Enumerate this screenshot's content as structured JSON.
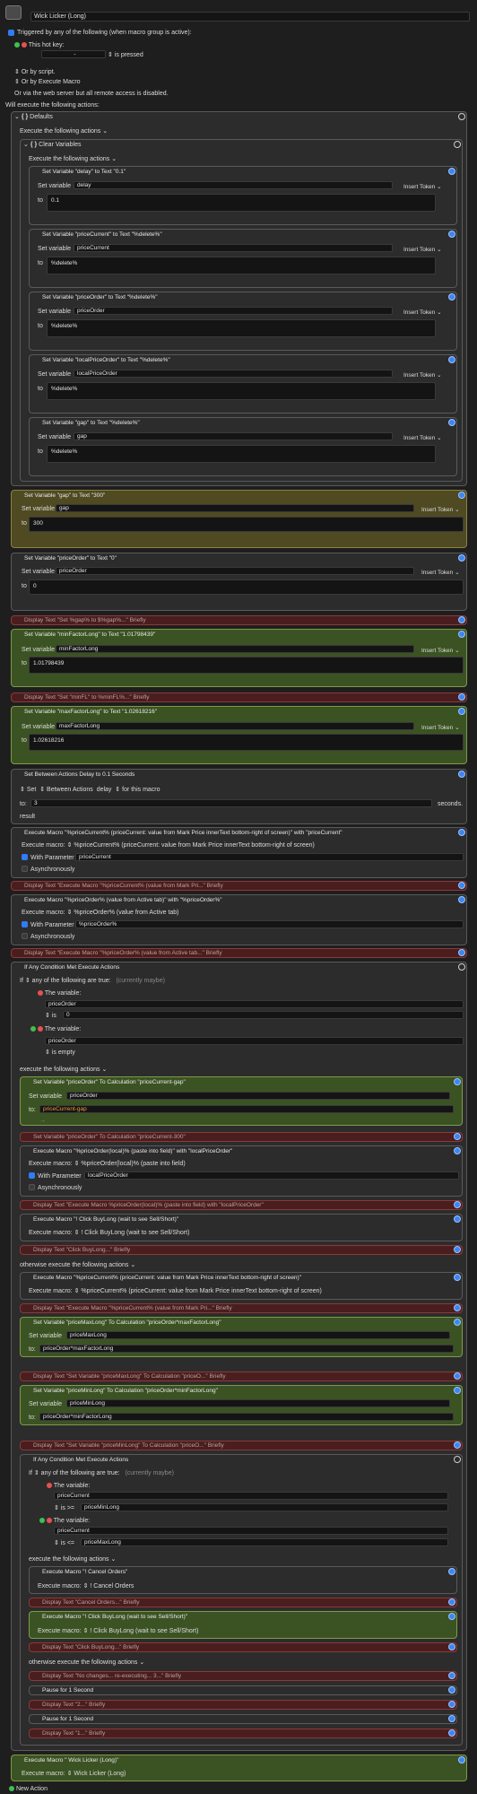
{
  "macro": {
    "title": "Wick Licker (Long)"
  },
  "trigger": {
    "triggered_by": "Triggered by any of the following (when macro group is active):",
    "hot_key_label": "This hot key:",
    "hot_key_value": "-",
    "is_pressed": "is pressed",
    "or_script": "Or by script.",
    "or_execute": "Or by Execute Macro",
    "or_web": "Or via the web server but all remote access is disabled."
  },
  "will_execute": "Will execute the following actions:",
  "defaults": {
    "title": "Defaults",
    "exec": "Execute the following actions",
    "clear": {
      "title": "Clear Variables",
      "exec": "Execute the following actions",
      "items": [
        {
          "header": "Set Variable \"delay\" to Text \"0.1\"",
          "var": "delay",
          "to": "0.1"
        },
        {
          "header": "Set Variable \"priceCurrent\" to Text \"%delete%\"",
          "var": "priceCurrent",
          "to": "%delete%"
        },
        {
          "header": "Set Variable \"priceOrder\" to Text \"%delete%\"",
          "var": "priceOrder",
          "to": "%delete%"
        },
        {
          "header": "Set Variable \"localPriceOrder\" to Text \"%delete%\"",
          "var": "localPriceOrder",
          "to": "%delete%"
        },
        {
          "header": "Set Variable \"gap\" to Text \"%delete%\"",
          "var": "gap",
          "to": "%delete%"
        }
      ]
    }
  },
  "labels": {
    "set_variable": "Set variable",
    "to": "to:",
    "insert_token": "Insert Token",
    "execute_macro": "Execute macro:",
    "with_parameter": "With Parameter",
    "asynchronously": "Asynchronously",
    "set": "Set",
    "between": "Between Actions",
    "delay": "delay",
    "for_macro": "for this macro",
    "seconds": "seconds.",
    "result": "result",
    "if": "If",
    "any_true": "any of the following are true:",
    "currently_maybe": "(currently maybe)",
    "the_variable": "The variable:",
    "is": "is",
    "is_empty": "is empty",
    "exec_following": "execute the following actions",
    "otherwise": "otherwise execute the following actions",
    "new_action": "New Action"
  },
  "a_gap": {
    "header": "Set Variable \"gap\" to Text \"300\"",
    "var": "gap",
    "to": "300"
  },
  "a_po": {
    "header": "Set Variable \"priceOrder\" to Text \"0\"",
    "var": "priceOrder",
    "to": "0"
  },
  "d1": "Display Text \"Set %gap% to $%gap%...\" Briefly",
  "a_min": {
    "header": "Set Variable \"minFactorLong\" to Text \"1.01798439\"",
    "var": "minFactorLong",
    "to": "1.01798439"
  },
  "d2": "Display Text \"Set \"minFL\" to %minFL%...\" Briefly",
  "a_max": {
    "header": "Set Variable \"maxFactorLong\" to Text \"1.02618216\"",
    "var": "maxFactorLong",
    "to": "1.02618216"
  },
  "a_delay": {
    "header": "Set Between Actions Delay to 0.1 Seconds",
    "to": "3"
  },
  "a_em1": {
    "header": "Execute Macro \"%priceCurrent% (priceCurrent: value from Mark Price innerText bottom-right of screen)\" with \"priceCurrent\"",
    "macro": "%priceCurrent% (priceCurrent: value from Mark Price innerText bottom-right of screen)",
    "param": "priceCurrent"
  },
  "d3": "Display Text \"Execute Macro \"%priceCurrent% (value from Mark Pri...\" Briefly",
  "a_em2": {
    "header": "Execute Macro \"%priceOrder% (value from Active tab)\" with \"%priceOrder%\"",
    "macro": "%priceOrder% (value from Active tab)",
    "param": "%priceOrder%"
  },
  "d4": "Display Text \"Execute Macro \"%priceOrder% (value from Active tab...\" Briefly",
  "ifc": {
    "header": "If Any Condition Met Execute Actions",
    "c1_var": "priceOrder",
    "c1_val": "0",
    "c2_var": "priceOrder",
    "calc1": {
      "header": "Set Variable \"priceOrder\" To Calculation \"priceCurrent-gap\"",
      "var": "priceOrder",
      "to": "priceCurrent-gap"
    },
    "s300": "Set Variable \"priceOrder\" To Calculation \"priceCurrent-300\"",
    "em3": {
      "header": "Execute Macro \"%priceOrder(local)% (paste into field)\" with \"localPriceOrder\"",
      "macro": "%priceOrder(local)% (paste into field)",
      "param": "localPriceOrder"
    },
    "d5": "Display Text \"Execute Macro %priceOrder(local)% (paste into field) with \"localPriceOrder\"",
    "em4": {
      "header": "Execute Macro \"! Click BuyLong (wait to see Sell/Short)\"",
      "macro": "! Click BuyLong (wait to see Sell/Short)"
    },
    "d6": "Display Text \"Click BuyLong...\" Briefly",
    "em5": {
      "header": "Execute Macro \"%priceCurrent% (priceCurrent: value from Mark Price innerText bottom-right of screen)\"",
      "macro": "%priceCurrent% (priceCurrent: value from Mark Price innerText bottom-right of screen)"
    },
    "d7": "Display Text \"Execute Macro \"%priceCurrent% (value from Mark Pri...\" Briefly",
    "calc2": {
      "header": "Set Variable \"priceMaxLong\" To Calculation \"priceOrder*maxFactorLong\"",
      "var": "priceMaxLong",
      "to": "priceOrder*maxFactorLong"
    },
    "d8": "Display Text \"Set Variable \"priceMaxLong\" To Calculation \"priceO...\" Briefly",
    "calc3": {
      "header": "Set Variable \"priceMinLong\" To Calculation \"priceOrder*minFactorLong\"",
      "var": "priceMinLong",
      "to": "priceOrder*minFactorLong"
    },
    "d9": "Display Text \"Set Variable \"priceMinLong\" To Calculation \"priceO...\" Briefly",
    "if2": {
      "header": "If Any Condition Met Execute Actions",
      "c1_var": "priceCurrent",
      "c1_op": "is >=",
      "c1_val": "priceMinLong",
      "c2_var": "priceCurrent",
      "c2_op": "is <=",
      "c2_val": "priceMaxLong",
      "em6": {
        "header": "Execute Macro \"! Cancel Orders\"",
        "macro": "! Cancel Orders"
      },
      "d10": "Display Text \"Cancel Orders...\" Briefly",
      "em7": {
        "header": "Execute Macro \"! Click BuyLong (wait to see Sell/Short)\"",
        "macro": "! Click BuyLong (wait to see Sell/Short)"
      },
      "d11": "Display Text \"Click BuyLong...\" Briefly",
      "o1": "Display Text \"No changes... re-executing... 3...\" Briefly",
      "o2": "Pause for 1 Second",
      "o3": "Display Text \"2...\" Briefly",
      "o4": "Pause for 1 Second",
      "o5": "Display Text \"1...\" Briefly"
    }
  },
  "a_final": {
    "header": "Execute Macro \" Wick Licker (Long)\"",
    "macro": "Wick Licker (Long)"
  }
}
